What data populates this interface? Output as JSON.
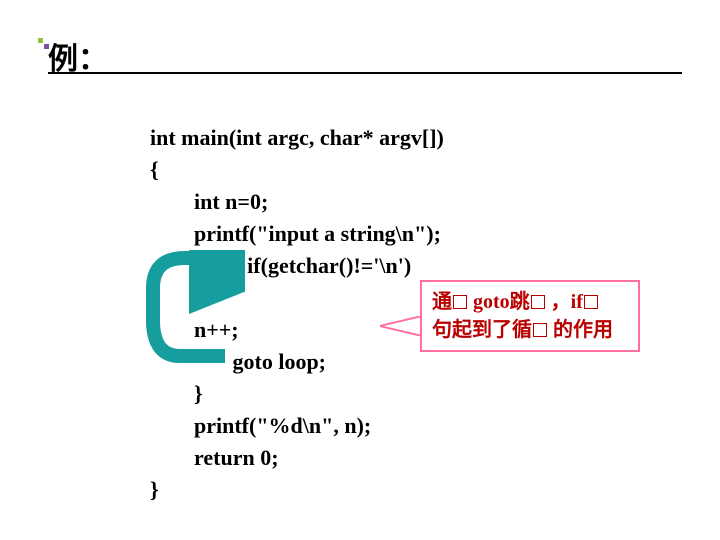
{
  "heading": "例：",
  "code": {
    "l01": "int main(int argc, char* argv[])",
    "l02": "{",
    "l03": "        int n=0;",
    "l04": "        printf(\"input a string\\n\");",
    "l05": "        loop: if(getchar()!='\\n')",
    "l06": "        {",
    "l07": "        n++;",
    "l08": "               goto loop;",
    "l09": "        }",
    "l10": "        printf(\"%d\\n\", n);",
    "l11": "        return 0;",
    "l12": "}"
  },
  "callout": {
    "line1_a": "通",
    "line1_b": " goto跳",
    "line1_c": " ，if",
    "line2_a": "句起到了循",
    "line2_b": " 的作用"
  }
}
